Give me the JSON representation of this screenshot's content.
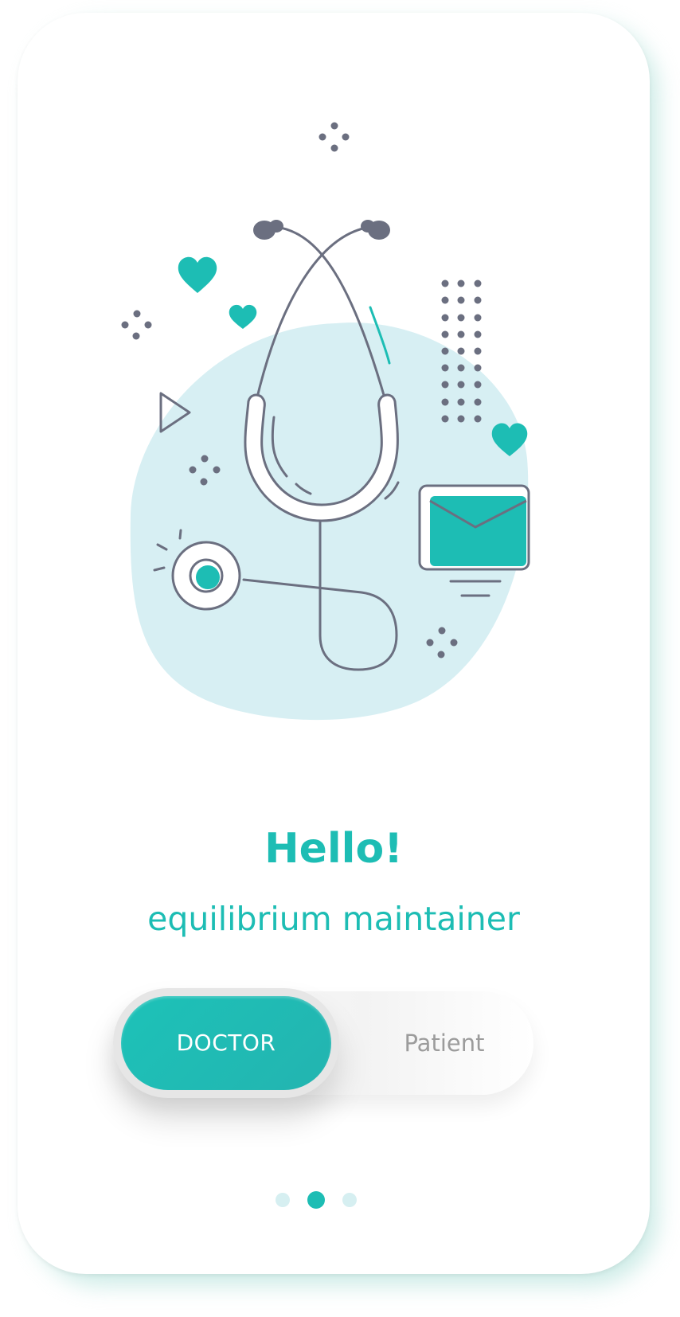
{
  "colors": {
    "accent": "#1dbdb4",
    "blob": "#d7eff3",
    "stroke": "#6b6f80",
    "inactive_dot": "#d6eff1",
    "muted_text": "#9c9c9c"
  },
  "illustration": {
    "icons": [
      "stethoscope-icon",
      "heart-icon",
      "envelope-icon",
      "play-icon",
      "dot-grid"
    ]
  },
  "greeting": {
    "title": "Hello!",
    "subtitle": "equilibrium maintainer"
  },
  "role_toggle": {
    "selected": "DOCTOR",
    "options": [
      {
        "label": "DOCTOR",
        "active": true
      },
      {
        "label": "Patient",
        "active": false
      }
    ]
  },
  "pagination": {
    "count": 3,
    "active_index": 1
  }
}
